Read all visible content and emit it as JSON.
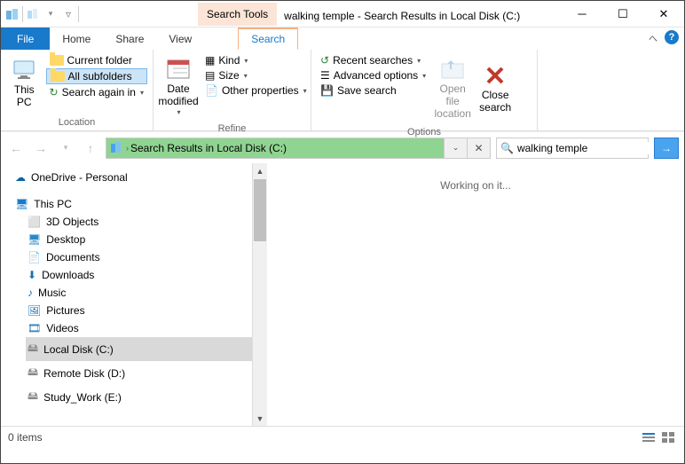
{
  "title": {
    "context_tab": "Search Tools",
    "window": "walking temple - Search Results in Local Disk (C:)"
  },
  "tabs": {
    "file": "File",
    "home": "Home",
    "share": "Share",
    "view": "View",
    "search": "Search"
  },
  "ribbon": {
    "location": {
      "this_pc": "This\nPC",
      "current_folder": "Current folder",
      "all_subfolders": "All subfolders",
      "search_again": "Search again in",
      "label": "Location"
    },
    "refine": {
      "date_modified": "Date\nmodified",
      "kind": "Kind",
      "size": "Size",
      "other_props": "Other properties",
      "label": "Refine"
    },
    "options": {
      "recent": "Recent searches",
      "advanced": "Advanced options",
      "save": "Save search",
      "open_loc": "Open file\nlocation",
      "close": "Close\nsearch",
      "label": "Options"
    }
  },
  "address": "Search Results in Local Disk (C:)",
  "search": {
    "query": "walking temple"
  },
  "tree": {
    "onedrive": "OneDrive - Personal",
    "this_pc": "This PC",
    "items": [
      "3D Objects",
      "Desktop",
      "Documents",
      "Downloads",
      "Music",
      "Pictures",
      "Videos",
      "Local Disk (C:)",
      "Remote Disk (D:)",
      "Study_Work (E:)"
    ]
  },
  "results_msg": "Working on it...",
  "status": "0 items"
}
